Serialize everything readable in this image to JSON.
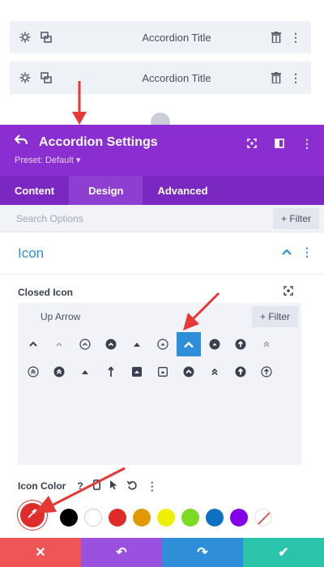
{
  "module_list": {
    "rows": [
      {
        "title": "Accordion Title"
      },
      {
        "title": "Accordion Title"
      }
    ]
  },
  "panel": {
    "title": "Accordion Settings",
    "preset": "Preset: Default ▾",
    "tabs": [
      {
        "label": "Content",
        "active": false
      },
      {
        "label": "Design",
        "active": true
      },
      {
        "label": "Advanced",
        "active": false
      }
    ],
    "search_placeholder": "Search Options",
    "filter_label": "+ Filter",
    "section_title": "Icon",
    "closed_icon_label": "Closed Icon",
    "icon_picker": {
      "selected_value": "Up Arrow",
      "filter_label": "+ Filter"
    },
    "icon_color_label": "Icon Color",
    "swatches": [
      "#000000",
      "#ffffff",
      "#e02b2b",
      "#e09900",
      "#edf000",
      "#7cda24",
      "#0c71c3",
      "#8300e9"
    ],
    "footer": [
      {
        "name": "discard",
        "glyph": "✕",
        "color": "#ef5555"
      },
      {
        "name": "undo",
        "glyph": "↶",
        "color": "#9b51e0"
      },
      {
        "name": "redo",
        "glyph": "↷",
        "color": "#2e8fd8"
      },
      {
        "name": "save",
        "glyph": "✔",
        "color": "#29c4a9"
      }
    ]
  },
  "colors": {
    "header_purple": "#8a2ed1",
    "tabs_purple": "#7b27c2",
    "accent_blue": "#2e8fd8",
    "annotation_red": "#e53935"
  }
}
